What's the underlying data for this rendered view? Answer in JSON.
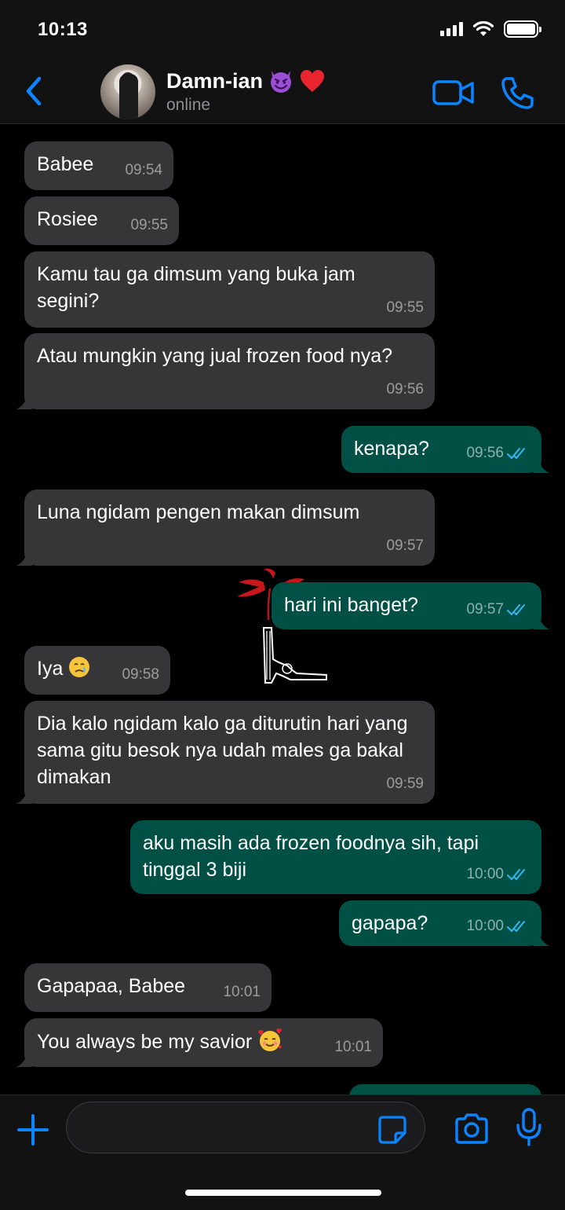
{
  "status_bar": {
    "time": "10:13"
  },
  "header": {
    "contact_name": "Damn-ian",
    "name_icons": [
      "smiling-devil-icon",
      "red-heart-icon"
    ],
    "status": "online"
  },
  "messages": [
    {
      "dir": "in",
      "text": "Babee",
      "time": "09:54"
    },
    {
      "dir": "in",
      "text": "Rosiee",
      "time": "09:55"
    },
    {
      "dir": "in",
      "text": "Kamu tau ga dimsum yang buka jam segini?",
      "time": "09:55"
    },
    {
      "dir": "in",
      "text": "Atau mungkin yang jual frozen food nya?",
      "time": "09:56"
    },
    {
      "dir": "out",
      "text": "kenapa?",
      "time": "09:56",
      "read": true
    },
    {
      "dir": "in",
      "text": "Luna ngidam pengen makan dimsum",
      "time": "09:57"
    },
    {
      "dir": "out",
      "text": "hari ini banget?",
      "time": "09:57",
      "read": true
    },
    {
      "dir": "in",
      "text": "Iya",
      "emoji": "crying-face-icon",
      "time": "09:58"
    },
    {
      "dir": "in",
      "text": "Dia kalo ngidam kalo ga diturutin hari yang sama gitu besok nya udah males ga bakal dimakan",
      "time": "09:59"
    },
    {
      "dir": "out",
      "text": "aku masih ada frozen foodnya sih, tapi tinggal 3 biji",
      "time": "10:00",
      "read": true
    },
    {
      "dir": "out",
      "text": "gapapa?",
      "time": "10:00",
      "read": true
    },
    {
      "dir": "in",
      "text": "Gapapaa, Babee",
      "time": "10:01"
    },
    {
      "dir": "in",
      "text": "You always be my savior",
      "emoji": "smiling-face-with-hearts-icon",
      "time": "10:01"
    }
  ],
  "colors": {
    "incoming_bubble": "#363638",
    "outgoing_bubble": "#005046",
    "accent": "#0a84ff",
    "read_ticks": "#34b7f1"
  },
  "input": {
    "value": "",
    "placeholder": ""
  }
}
